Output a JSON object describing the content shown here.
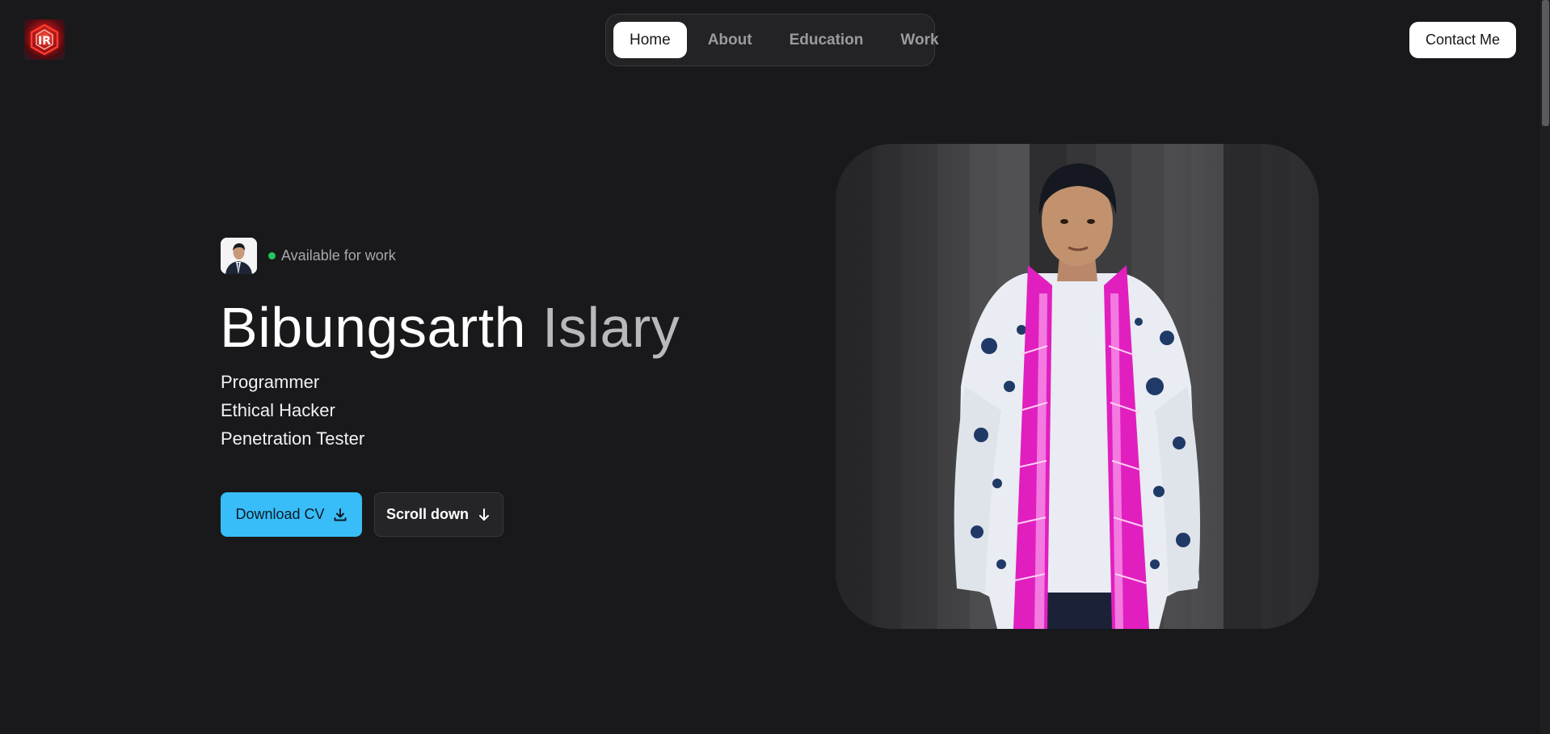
{
  "header": {
    "logo_text": "IR",
    "nav": [
      {
        "label": "Home",
        "active": true
      },
      {
        "label": "About",
        "active": false
      },
      {
        "label": "Education",
        "active": false
      },
      {
        "label": "Work",
        "active": false
      }
    ],
    "contact_label": "Contact Me"
  },
  "hero": {
    "status": "Available for work",
    "status_color": "#22c55e",
    "first_name": "Bibungsarth",
    "last_name": "Islary",
    "roles": [
      "Programmer",
      "Ethical Hacker",
      "Penetration Tester"
    ],
    "download_label": "Download CV",
    "download_icon": "download-icon",
    "scroll_label": "Scroll down",
    "scroll_icon": "arrow-down-icon",
    "accent": "#38bdf8"
  }
}
